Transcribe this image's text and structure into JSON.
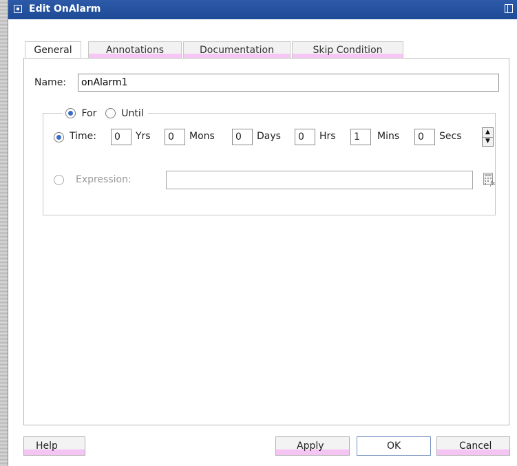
{
  "window": {
    "title": "Edit OnAlarm"
  },
  "tabs": [
    {
      "label": "General",
      "active": true
    },
    {
      "label": "Annotations",
      "active": false
    },
    {
      "label": "Documentation",
      "active": false
    },
    {
      "label": "Skip Condition",
      "active": false
    }
  ],
  "name_field": {
    "label": "Name:",
    "value": "onAlarm1"
  },
  "mode_group": {
    "for_label": "For",
    "until_label": "Until",
    "selected": "For"
  },
  "time_row": {
    "label": "Time:",
    "selected": true,
    "years": {
      "value": "0",
      "unit": "Yrs"
    },
    "months": {
      "value": "0",
      "unit": "Mons"
    },
    "days": {
      "value": "0",
      "unit": "Days"
    },
    "hours": {
      "value": "0",
      "unit": "Hrs"
    },
    "minutes": {
      "value": "1",
      "unit": "Mins"
    },
    "seconds": {
      "value": "0",
      "unit": "Secs"
    }
  },
  "expression_row": {
    "label": "Expression:",
    "value": "",
    "enabled": false,
    "icon": "expression-builder-icon"
  },
  "buttons": {
    "help": "Help",
    "apply": "Apply",
    "ok": "OK",
    "cancel": "Cancel"
  },
  "colors": {
    "titlebar": "#2d5aa8",
    "radio_selected": "#3b6cc8",
    "button_accent": "#f4c4f2"
  }
}
